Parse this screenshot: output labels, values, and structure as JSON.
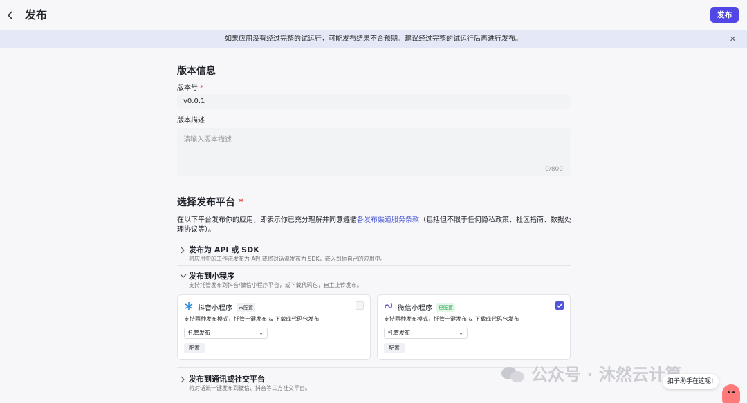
{
  "header": {
    "back_icon": "chevron-left-icon",
    "title": "发布",
    "publish_label": "发布"
  },
  "banner": {
    "text": "如果应用没有经过完整的试运行，可能发布结果不合预期。建议经过完整的试运行后再进行发布。",
    "close_icon": "close-icon"
  },
  "version_info": {
    "heading": "版本信息",
    "version_label": "版本号",
    "required_mark": "*",
    "version_value": "v0.0.1",
    "desc_label": "版本描述",
    "desc_placeholder": "请输入版本描述",
    "desc_counter": "0/800"
  },
  "platform": {
    "heading": "选择发布平台",
    "required_mark": "*",
    "desc_prefix": "在以下平台发布你的应用，即表示你已充分理解并同意遵循",
    "desc_link": "各发布渠道服务条款",
    "desc_suffix": "（包括但不限于任何隐私政策、社区指南、数据处理协议等）。",
    "groups": [
      {
        "title": "发布为 API 或 SDK",
        "subtitle": "将应用中的工作流发布为 API 或将对话流发布为 SDK，嵌入到你自己的应用中。",
        "expanded": false
      },
      {
        "title": "发布到小程序",
        "subtitle": "支持托管发布到抖音/微信小程序平台，或下载代码包，自主上传发布。",
        "expanded": true
      },
      {
        "title": "发布到通讯或社交平台",
        "subtitle": "将对话流一键发布到微信、抖音等三方社交平台。",
        "expanded": false
      }
    ],
    "cards": [
      {
        "name": "抖音小程序",
        "badge": "未配置",
        "desc": "支持两种发布模式，托管一键发布 & 下载成代码包发布",
        "mode": "托管发布",
        "config_label": "配置",
        "checked": false,
        "icon": "douyin-icon"
      },
      {
        "name": "微信小程序",
        "badge": "已配置",
        "desc": "支持两种发布模式，托管一键发布 & 下载成代码包发布",
        "mode": "托管发布",
        "config_label": "配置",
        "checked": true,
        "icon": "wechat-miniprogram-icon"
      }
    ]
  },
  "watermark": {
    "text": "公众号 · 沐然云计算"
  },
  "helper": {
    "text": "扣子助手在这呢!"
  },
  "colors": {
    "accent": "#5147e6",
    "banner_bg": "#e5e8f7",
    "link": "#4c5bd4",
    "configured": "#21a04a"
  }
}
